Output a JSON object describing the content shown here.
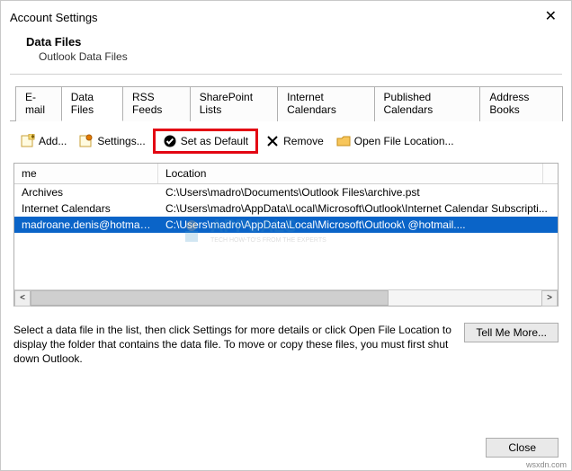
{
  "window": {
    "title": "Account Settings"
  },
  "header": {
    "title": "Data Files",
    "sub": "Outlook Data Files"
  },
  "tabs": [
    {
      "label": "E-mail",
      "active": false
    },
    {
      "label": "Data Files",
      "active": true
    },
    {
      "label": "RSS Feeds",
      "active": false
    },
    {
      "label": "SharePoint Lists",
      "active": false
    },
    {
      "label": "Internet Calendars",
      "active": false
    },
    {
      "label": "Published Calendars",
      "active": false
    },
    {
      "label": "Address Books",
      "active": false
    }
  ],
  "toolbar": {
    "add": "Add...",
    "settings": "Settings...",
    "set_default": "Set as Default",
    "remove": "Remove",
    "open_loc": "Open File Location..."
  },
  "table": {
    "col_name": "me",
    "col_loc": "Location",
    "rows": [
      {
        "name": "Archives",
        "loc": "C:\\Users\\madro\\Documents\\Outlook Files\\archive.pst",
        "selected": false
      },
      {
        "name": "Internet Calendars",
        "loc": "C:\\Users\\madro\\AppData\\Local\\Microsoft\\Outlook\\Internet Calendar Subscripti...",
        "selected": false
      },
      {
        "name": "madroane.denis@hotmail.c...",
        "loc": "C:\\Users\\madro\\AppData\\Local\\Microsoft\\Outlook\\                      @hotmail....",
        "selected": true
      }
    ]
  },
  "info": {
    "text": "Select a data file in the list, then click Settings for more details or click Open File Location to display the folder that contains the data file. To move or copy these files, you must first shut down Outlook.",
    "tell_me_more": "Tell Me More..."
  },
  "footer": {
    "close": "Close"
  },
  "watermark": {
    "brand": "APPUALS",
    "tag": "TECH HOW-TO'S FROM THE EXPERTS"
  },
  "attrib": "wsxdn.com"
}
